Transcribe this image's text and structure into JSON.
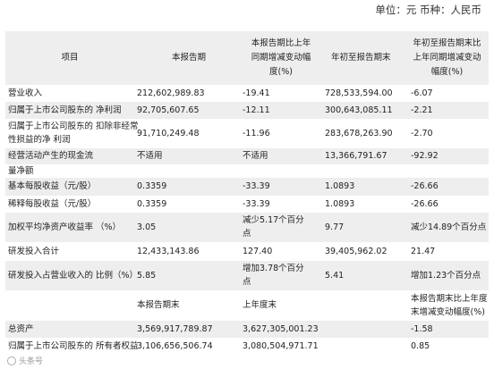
{
  "unit_label": "单位：元 币种：人民币",
  "header": {
    "item": "项目",
    "current": "本报告期",
    "change_lines": [
      "本报告期比上年",
      "同期增减变动幅",
      "度(%)"
    ],
    "ytd": "年初至报告期末",
    "ytd_change_lines": [
      "年初至报告期末比",
      "上年同期增减变动",
      "幅度(%)"
    ]
  },
  "rows": [
    {
      "label": "营业收入",
      "current": "212,602,989.83",
      "change": "-19.41",
      "ytd": "728,533,594.00",
      "ytd_change": "-6.07"
    },
    {
      "label": "归属于上市公司股东的 净利润",
      "current": "92,705,607.65",
      "change": "-12.11",
      "ytd": "300,643,085.11",
      "ytd_change": "-2.21"
    },
    {
      "label_lines": [
        "归属于上市公司股东的 扣除非经常",
        "性损益的净 利润"
      ],
      "current": "91,710,249.48",
      "change": "-11.96",
      "ytd": "283,678,263.90",
      "ytd_change": "-2.70"
    },
    {
      "label": "经营活动产生的现金流",
      "current": "不适用",
      "change": "不适用",
      "ytd": "13,366,791.67",
      "ytd_change": "-92.92"
    },
    {
      "label": "量净额",
      "current": "",
      "change": "",
      "ytd": "",
      "ytd_change": ""
    },
    {
      "label": "基本每股收益（元/股）",
      "current": "0.3359",
      "change": "-33.39",
      "ytd": "1.0893",
      "ytd_change": "-26.66"
    },
    {
      "label": "稀释每股收益（元/股）",
      "current": "0.3359",
      "change": "-33.39",
      "ytd": "1.0893",
      "ytd_change": "-26.66"
    },
    {
      "label": "加权平均净资产收益率 （%）",
      "current": "3.05",
      "change_lines": [
        "减少5.17个百分",
        "点"
      ],
      "ytd": "9.77",
      "ytd_change": "减少14.89个百分点"
    },
    {
      "label": "研发投入合计",
      "current": "12,433,143.86",
      "change": "127.40",
      "ytd": "39,405,962.02",
      "ytd_change": "21.47"
    },
    {
      "label": "研发投入占营业收入的 比例（%）",
      "current": "5.85",
      "change_lines": [
        "增加3.78个百分",
        "点"
      ],
      "ytd": "5.41",
      "ytd_change": "增加1.23个百分点"
    }
  ],
  "header2": {
    "current_end": "本报告期末",
    "prior_year_end": "上年度末",
    "change_lines": [
      "本报告期末比上年度",
      "末增减变动幅度(%)"
    ]
  },
  "rows2": [
    {
      "label": "总资产",
      "current_end": "3,569,917,789.87",
      "prior_year_end": "3,627,305,001.23",
      "change": "-1.58"
    },
    {
      "label": "归属于上市公司股东的 所有者权益",
      "current_end": "3,106,656,506.74",
      "prior_year_end": "3,080,504,971.71",
      "change": "0.85"
    }
  ],
  "watermark": "头条号"
}
